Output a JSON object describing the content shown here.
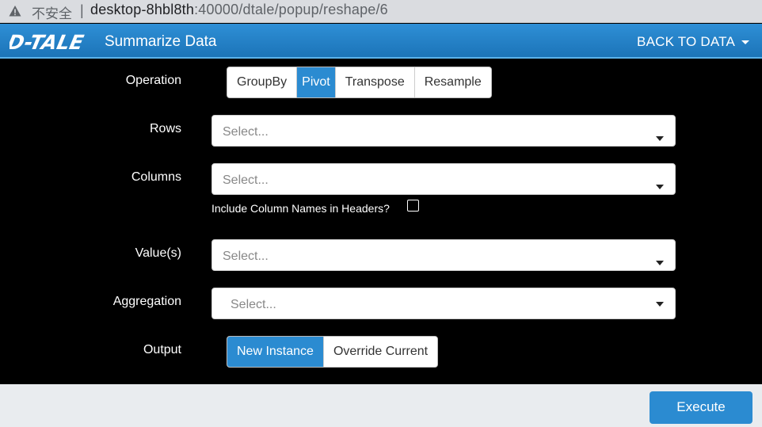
{
  "browser": {
    "insecure_label": "不安全",
    "separator": "|",
    "url_host": "desktop-8hbl8th",
    "url_rest": ":40000/dtale/popup/reshape/6"
  },
  "header": {
    "logo_text": "D-TALE",
    "title": "Summarize Data",
    "back_label": "BACK TO DATA"
  },
  "form": {
    "operation": {
      "label": "Operation",
      "options": [
        "GroupBy",
        "Pivot",
        "Transpose",
        "Resample"
      ],
      "selected": "Pivot"
    },
    "rows": {
      "label": "Rows",
      "placeholder": "Select..."
    },
    "columns": {
      "label": "Columns",
      "placeholder": "Select...",
      "checkbox_label": "Include Column Names in Headers?",
      "checkbox_checked": false
    },
    "values": {
      "label": "Value(s)",
      "placeholder": "Select..."
    },
    "aggregation": {
      "label": "Aggregation",
      "placeholder": "Select..."
    },
    "output": {
      "label": "Output",
      "options": [
        "New Instance",
        "Override Current"
      ],
      "selected": "New Instance"
    }
  },
  "footer": {
    "execute_label": "Execute"
  },
  "colors": {
    "accent": "#2b8bd1",
    "header": "#1f7bc1",
    "background": "#000000"
  }
}
